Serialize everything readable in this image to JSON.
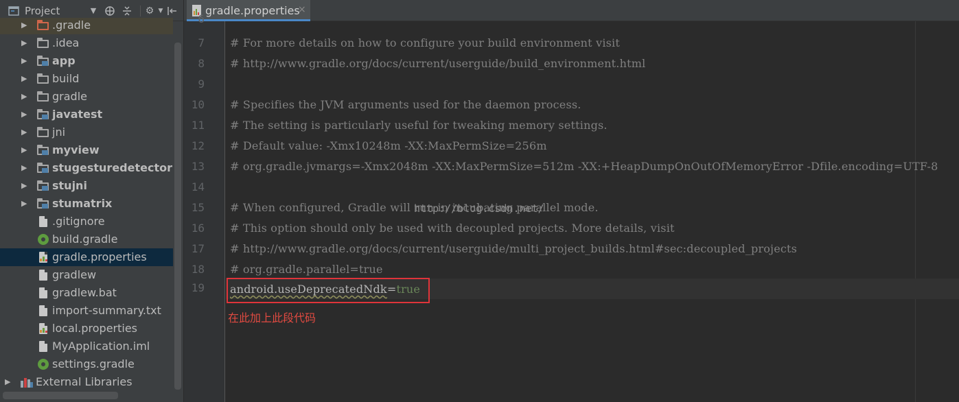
{
  "project_panel": {
    "title": "Project",
    "toolbar_icons": [
      "dropdown-icon",
      "target-icon",
      "collapse-all-icon",
      "gear-icon",
      "hide-icon"
    ],
    "tree": [
      {
        "label": ".gradle",
        "icon": "folder-orange",
        "expandable": true,
        "bold": false
      },
      {
        "label": ".idea",
        "icon": "folder",
        "expandable": true,
        "bold": false
      },
      {
        "label": "app",
        "icon": "module",
        "expandable": true,
        "bold": true
      },
      {
        "label": "build",
        "icon": "folder",
        "expandable": true,
        "bold": false
      },
      {
        "label": "gradle",
        "icon": "folder",
        "expandable": true,
        "bold": false
      },
      {
        "label": "javatest",
        "icon": "module",
        "expandable": true,
        "bold": true
      },
      {
        "label": "jni",
        "icon": "folder",
        "expandable": true,
        "bold": false
      },
      {
        "label": "myview",
        "icon": "module",
        "expandable": true,
        "bold": true
      },
      {
        "label": "stugesturedetector",
        "icon": "module",
        "expandable": true,
        "bold": true
      },
      {
        "label": "stujni",
        "icon": "module",
        "expandable": true,
        "bold": true
      },
      {
        "label": "stumatrix",
        "icon": "module",
        "expandable": true,
        "bold": true
      },
      {
        "label": ".gitignore",
        "icon": "file",
        "expandable": false,
        "bold": false
      },
      {
        "label": "build.gradle",
        "icon": "gradle",
        "expandable": false,
        "bold": false
      },
      {
        "label": "gradle.properties",
        "icon": "properties",
        "expandable": false,
        "bold": false,
        "selected": true
      },
      {
        "label": "gradlew",
        "icon": "file",
        "expandable": false,
        "bold": false
      },
      {
        "label": "gradlew.bat",
        "icon": "file",
        "expandable": false,
        "bold": false
      },
      {
        "label": "import-summary.txt",
        "icon": "file",
        "expandable": false,
        "bold": false
      },
      {
        "label": "local.properties",
        "icon": "properties",
        "expandable": false,
        "bold": false
      },
      {
        "label": "MyApplication.iml",
        "icon": "file",
        "expandable": false,
        "bold": false
      },
      {
        "label": "settings.gradle",
        "icon": "gradle",
        "expandable": false,
        "bold": false
      },
      {
        "label": "External Libraries",
        "icon": "libraries",
        "expandable": true,
        "bold": false
      }
    ]
  },
  "editor": {
    "tab": {
      "label": "gradle.properties",
      "close": "×"
    },
    "partial_line_number": "6",
    "lines": [
      {
        "n": "7",
        "text": "# For more details on how to configure your build environment visit"
      },
      {
        "n": "8",
        "text": "# http://www.gradle.org/docs/current/userguide/build_environment.html"
      },
      {
        "n": "9",
        "text": ""
      },
      {
        "n": "10",
        "text": "# Specifies the JVM arguments used for the daemon process."
      },
      {
        "n": "11",
        "text": "# The setting is particularly useful for tweaking memory settings."
      },
      {
        "n": "12",
        "text": "# Default value: -Xmx10248m -XX:MaxPermSize=256m"
      },
      {
        "n": "13",
        "text": "# org.gradle.jvmargs=-Xmx2048m -XX:MaxPermSize=512m -XX:+HeapDumpOnOutOfMemoryError -Dfile.encoding=UTF-8"
      },
      {
        "n": "14",
        "text": ""
      },
      {
        "n": "15",
        "text": "# When configured, Gradle will run in incubating parallel mode."
      },
      {
        "n": "16",
        "text": "# This option should only be used with decoupled projects. More details, visit"
      },
      {
        "n": "17",
        "text": "# http://www.gradle.org/docs/current/userguide/multi_project_builds.html#sec:decoupled_projects"
      },
      {
        "n": "18",
        "text": "# org.gradle.parallel=true"
      }
    ],
    "highlighted_line": {
      "n": "19",
      "key": "android.useDeprecatedNdk",
      "eq": "=",
      "value": "true"
    },
    "annotation": "在此加上此段代码",
    "watermark": "http://blog.csdn.net/"
  },
  "colors": {
    "panel_bg": "#3c3f41",
    "editor_bg": "#2b2b2b",
    "selection": "#0d293e",
    "comment": "#808080",
    "value_green": "#6a8759",
    "annotation_red": "#e0343a"
  }
}
